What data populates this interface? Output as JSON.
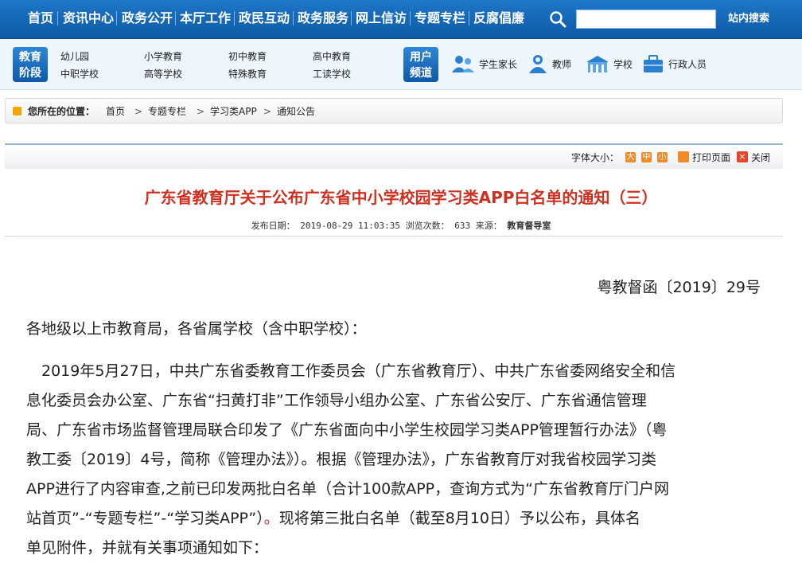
{
  "topnav": {
    "items": [
      "首页",
      "资讯中心",
      "政务公开",
      "本厅工作",
      "政民互动",
      "政务服务",
      "网上信访",
      "专题专栏",
      "反腐倡廉"
    ],
    "search_label": "站内搜索"
  },
  "subnav": {
    "edu_badge": [
      "教育",
      "阶段"
    ],
    "stages": [
      "幼儿园",
      "中职学校",
      "小学教育",
      "高等学校",
      "初中教育",
      "特殊教育",
      "高中教育",
      "工读学校"
    ],
    "user_badge": [
      "用户",
      "频道"
    ],
    "user_types": [
      "学生家长",
      "教师",
      "学校",
      "行政人员"
    ]
  },
  "breadcrumb": {
    "label": "您所在的位置：",
    "items": [
      "首页",
      "专题专栏",
      "学习类APP",
      "通知公告"
    ],
    "sep": ">"
  },
  "toolbar": {
    "font_size_label": "字体大小：",
    "sizes": [
      "大",
      "中",
      "小"
    ],
    "print": "打印页面",
    "close": "关闭"
  },
  "article": {
    "title": "广东省教育厅关于公布广东省中小学校园学习类APP白名单的通知（三）",
    "meta_date_label": "发布日期：",
    "meta_date": "2019-08-29 11:03:35",
    "meta_views_label": "浏览次数：",
    "meta_views": "633",
    "meta_source_label": "来源：",
    "meta_source": "教育督导室",
    "doc_number": "粤教督函〔2019〕29号",
    "salutation": "各地级以上市教育局，各省属学校（含中职学校）：",
    "lines": [
      "　2019年5月27日，中共广东省委教育工作委员会（广东省教育厅）、中共广东省委网络安全和信",
      "息化委员会办公室、广东省“扫黄打非”工作领导小组办公室、广东省公安厅、广东省通信管理",
      "局、广东省市场监督管理局联合印发了《广东省面向中小学生校园学习类APP管理暂行办法》（粤",
      "教工委〔2019〕4号，简称《管理办法》）。根据《管理办法》，广东省教育厅对我省校园学习类",
      "APP进行了内容审查,之前已印发两批白名单（合计100款APP，查询方式为“广东省教育厅门户网",
      "站首页”-“专题专栏”-“学习类APP”）",
      "。",
      "现将第三批白名单（截至8月10日）予以公布，具体名",
      "单见附件，并就有关事项通知如下："
    ]
  },
  "colors": {
    "nav_blue": "#0d5aa6",
    "title_red": "#d0301f",
    "accent_orange": "#f08b2c"
  }
}
